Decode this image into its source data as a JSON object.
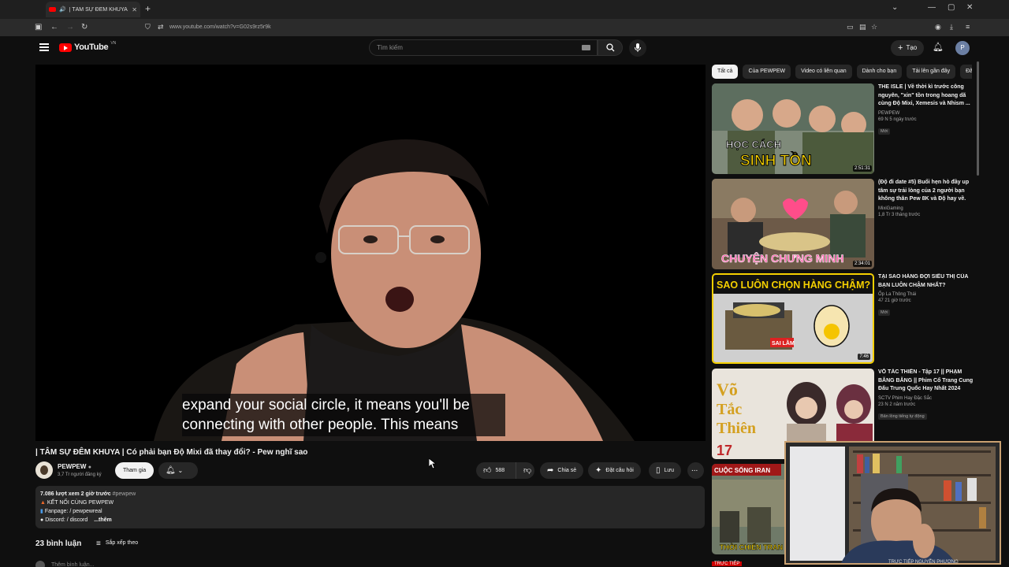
{
  "browser": {
    "tab_title": "| TÂM SỰ ĐÊM KHUYA | Có",
    "url": "www.youtube.com/watch?v=G02s9rz5r9k"
  },
  "header": {
    "logo_text": "YouTube",
    "logo_region": "VN",
    "search_placeholder": "Tìm kiếm",
    "create_label": "Tạo",
    "avatar_letter": "P"
  },
  "player": {
    "caption_line1": "expand your social circle, it means you'll be",
    "caption_line2": "connecting with other people.  This means"
  },
  "video": {
    "title": "| TÂM SỰ ĐÊM KHUYA | Có phải bạn Độ Mixi đã thay đổi? - Pew nghĩ sao",
    "channel": "PEWPEW",
    "subscribers": "3,7 Tr người đăng ký",
    "join_label": "Tham gia",
    "like_count": "588",
    "share_label": "Chia sẻ",
    "ask_label": "Đặt câu hỏi",
    "save_label": "Lưu",
    "more_label": "...",
    "description": {
      "meta": "7.086 lượt xem  2 giờ trước",
      "hashtag": "#pewpew",
      "line1": "KẾT NỐI CÙNG PEWPEW",
      "line2": "Fanpage:  / pewpewreal",
      "line3": "Discord:  / discord",
      "more": "...thêm"
    },
    "comments_count": "23 bình luận",
    "sort_label": "Sắp xếp theo",
    "add_comment_placeholder": "Thêm bình luận..."
  },
  "chips": [
    "Tất cả",
    "Của PEWPEW",
    "Video có liên quan",
    "Dành cho bạn",
    "Tải lên gần đây",
    "Đã"
  ],
  "recommendations": [
    {
      "title": "THE ISLE | Về thời kì trước công nguyên, \"xin\" tồn trong hoang dã cùng Độ Mixi, Xemesis và Nhism ...",
      "channel": "PEWPEW",
      "meta": "69 N  5 ngày trước",
      "badge": "Mới",
      "duration": "2:51:31",
      "thumb_text": "HỌC CÁCH SINH TỒN"
    },
    {
      "title": "(Độ đi date #5) Buổi hẹn hò đầy up tâm sự trải lòng của 2 người bạn không thân Pew 8K và Độ hay về.",
      "channel": "MixiGaming",
      "meta": "1,8 Tr  3 tháng trước",
      "badge": "",
      "duration": "2:34:01",
      "thumb_text": "CHUYỆN CHƯNG MINH"
    },
    {
      "title": "TẠI SAO HÀNG ĐỢI SIÊU THỊ CỦA BẠN LUÔN CHẬM NHẤT?",
      "channel": "Ốp La Thông Thái",
      "meta": "47  21 giờ trước",
      "badge": "Mới",
      "duration": "7:46",
      "thumb_text": "SAO LUÔN CHỌN HÀNG CHẬM?",
      "thumb_sub": "SAI LẦM"
    },
    {
      "title": "VÕ TẮC THIÊN - Tập 17 || PHẠM BĂNG BĂNG || Phim Cổ Trang Cung Đấu Trung Quốc Hay Nhất 2024",
      "channel": "SCTV Phim Hay Đặc Sắc",
      "meta": "23 N  2 năm trước",
      "badge": "Bản lồng tiếng tự động",
      "duration": "",
      "thumb_text": "Võ Tắc Thiên",
      "thumb_num": "17"
    },
    {
      "title": "",
      "channel": "",
      "meta": "",
      "badge": "",
      "duration": "",
      "thumb_text": "CUỘC SỐNG IRAN",
      "thumb_sub": "THỜI CHIẾN TRAN"
    }
  ],
  "overlay": {
    "live_label": "TRỰC TIẾP",
    "bottom_text": "TRỰC TIẾP NGUYỄN PHƯƠNG"
  },
  "colors": {
    "background": "#0f0f0f",
    "surface": "#272727",
    "brand_red": "#ff0000",
    "thumb_yellow": "#f5d000",
    "webcam_border": "#c9a070"
  }
}
